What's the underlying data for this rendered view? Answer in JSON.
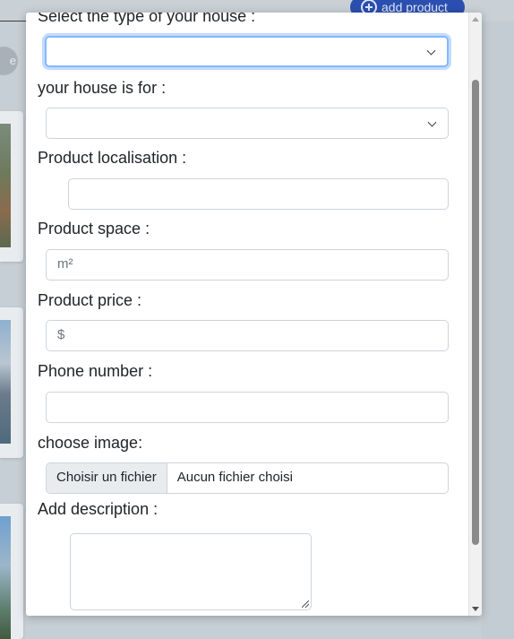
{
  "background": {
    "add_button_label": "add product",
    "circle_text": "e",
    "accent": "#2b4fb0"
  },
  "form": {
    "house_type": {
      "label": "Select the type of your house :",
      "value": ""
    },
    "house_for": {
      "label": "your house is for :",
      "value": ""
    },
    "localisation": {
      "label": "Product localisation :",
      "value": ""
    },
    "space": {
      "label": "Product space :",
      "placeholder": "m²"
    },
    "price": {
      "label": "Product price :",
      "placeholder": "$"
    },
    "phone": {
      "label": "Phone number :",
      "value": ""
    },
    "image": {
      "label": "choose image:",
      "button_label": "Choisir un fichier",
      "file_status": "Aucun fichier choisi"
    },
    "description": {
      "label": "Add description :",
      "value": ""
    }
  },
  "icons": {
    "select_arrow": "chevron-down-icon",
    "add": "plus-circle-icon"
  }
}
